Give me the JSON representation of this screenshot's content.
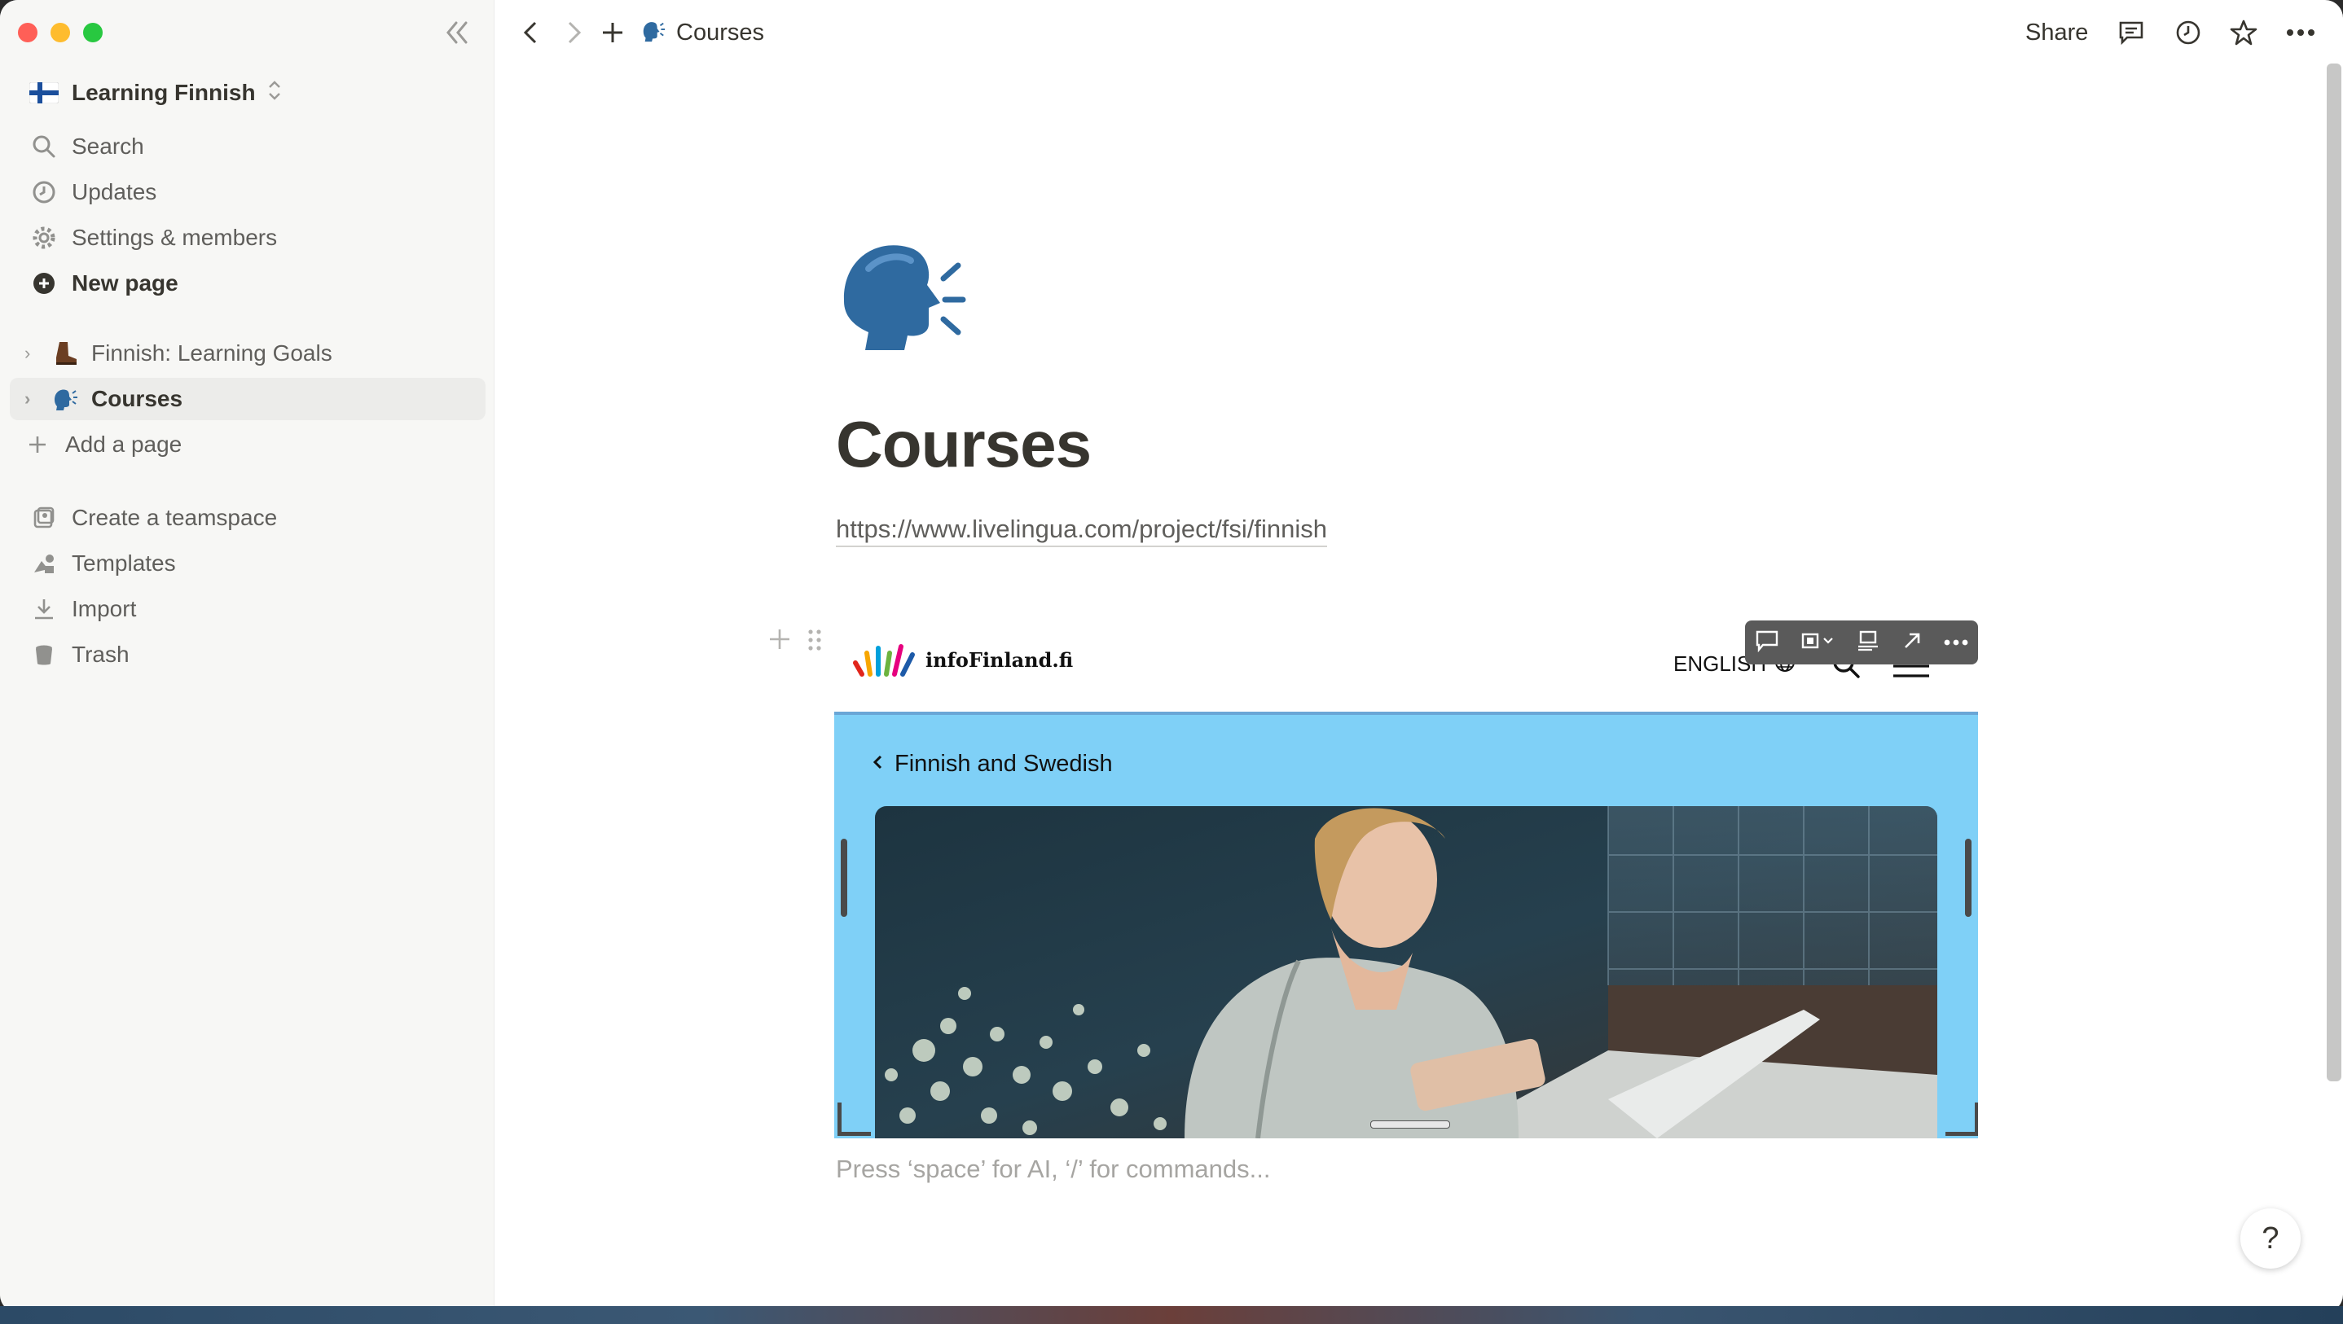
{
  "workspace": {
    "name": "Learning Finnish"
  },
  "sidebar": {
    "menu": [
      {
        "label": "Search",
        "icon": "search-icon"
      },
      {
        "label": "Updates",
        "icon": "clock-icon"
      },
      {
        "label": "Settings & members",
        "icon": "gear-icon"
      },
      {
        "label": "New page",
        "icon": "plus-circle-icon"
      }
    ],
    "pages": [
      {
        "label": "Finnish: Learning Goals",
        "icon": "boot-emoji"
      },
      {
        "label": "Courses",
        "icon": "speaking-head-emoji",
        "active": true
      }
    ],
    "add_page": "Add a page",
    "bottom": [
      {
        "label": "Create a teamspace",
        "icon": "teamspace-icon"
      },
      {
        "label": "Templates",
        "icon": "templates-icon"
      },
      {
        "label": "Import",
        "icon": "download-icon"
      },
      {
        "label": "Trash",
        "icon": "trash-icon"
      }
    ]
  },
  "topbar": {
    "breadcrumb": "Courses",
    "share": "Share"
  },
  "page": {
    "title": "Courses",
    "link": "https://www.livelingua.com/project/fsi/finnish",
    "hint": "Press ‘space’ for AI, ‘/’ for commands..."
  },
  "embed": {
    "site_name": "infoFinland.fi",
    "language": "ENGLISH",
    "back_link": "Finnish and Swedish"
  },
  "help": {
    "label": "?"
  },
  "colors": {
    "accent_blue": "#7fd0f7",
    "sidebar_bg": "#f7f7f5",
    "text": "#37352f"
  }
}
